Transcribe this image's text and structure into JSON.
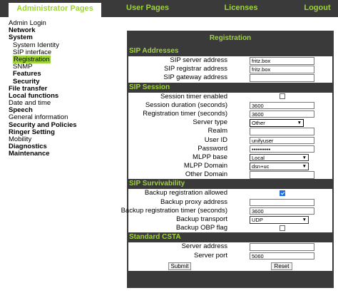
{
  "topnav": {
    "admin": "Administrator Pages",
    "user": "User Pages",
    "licenses": "Licenses",
    "logout": "Logout"
  },
  "sidebar": {
    "items": [
      {
        "label": "Admin Login",
        "bold": false,
        "sub": false
      },
      {
        "label": "Network",
        "bold": true,
        "sub": false
      },
      {
        "label": "System",
        "bold": true,
        "sub": false
      },
      {
        "label": "System Identity",
        "bold": false,
        "sub": true
      },
      {
        "label": "SIP interface",
        "bold": false,
        "sub": true
      },
      {
        "label": "Registration",
        "bold": false,
        "sub": true,
        "active": true
      },
      {
        "label": "SNMP",
        "bold": false,
        "sub": true
      },
      {
        "label": "Features",
        "bold": true,
        "sub": true
      },
      {
        "label": "Security",
        "bold": true,
        "sub": true
      },
      {
        "label": "File transfer",
        "bold": true,
        "sub": false
      },
      {
        "label": "Local functions",
        "bold": true,
        "sub": false
      },
      {
        "label": "Date and time",
        "bold": false,
        "sub": false
      },
      {
        "label": "Speech",
        "bold": true,
        "sub": false
      },
      {
        "label": "General information",
        "bold": false,
        "sub": false
      },
      {
        "label": "Security and Policies",
        "bold": true,
        "sub": false
      },
      {
        "label": "Ringer Setting",
        "bold": true,
        "sub": false
      },
      {
        "label": "Mobility",
        "bold": false,
        "sub": false
      },
      {
        "label": "Diagnostics",
        "bold": true,
        "sub": false
      },
      {
        "label": "Maintenance",
        "bold": true,
        "sub": false
      }
    ]
  },
  "panel": {
    "title": "Registration",
    "sip_addresses": {
      "heading": "SIP Addresses",
      "server_label": "SIP server address",
      "server_value": "fritz.box",
      "registrar_label": "SIP registrar address",
      "registrar_value": "fritz.box",
      "gateway_label": "SIP gateway address",
      "gateway_value": ""
    },
    "sip_session": {
      "heading": "SIP Session",
      "timer_enabled_label": "Session timer enabled",
      "timer_enabled": false,
      "duration_label": "Session duration (seconds)",
      "duration_value": "3600",
      "reg_timer_label": "Registration timer (seconds)",
      "reg_timer_value": "3600",
      "server_type_label": "Server type",
      "server_type_value": "Other",
      "realm_label": "Realm",
      "realm_value": "",
      "user_id_label": "User ID",
      "user_id_value": "unifyuser",
      "password_label": "Password",
      "password_value": "••••••••••",
      "mlpp_base_label": "MLPP base",
      "mlpp_base_value": "Local",
      "mlpp_domain_label": "MLPP Domain",
      "mlpp_domain_value": "dsn+uc",
      "other_domain_label": "Other Domain",
      "other_domain_value": ""
    },
    "sip_survivability": {
      "heading": "SIP Survivability",
      "backup_allowed_label": "Backup registration allowed",
      "backup_allowed": true,
      "backup_proxy_label": "Backup proxy address",
      "backup_proxy_value": "",
      "backup_timer_label": "Backup registration timer (seconds)",
      "backup_timer_value": "3600",
      "backup_transport_label": "Backup transport",
      "backup_transport_value": "UDP",
      "backup_obp_label": "Backup OBP flag",
      "backup_obp": false
    },
    "standard_csta": {
      "heading": "Standard CSTA",
      "server_address_label": "Server address",
      "server_address_value": "",
      "server_port_label": "Server port",
      "server_port_value": "5060"
    },
    "submit_label": "Submit",
    "reset_label": "Reset"
  },
  "colors": {
    "accent": "#9fd33a",
    "bar": "#3a3a3a",
    "checkbox": "#1f6fe5"
  }
}
